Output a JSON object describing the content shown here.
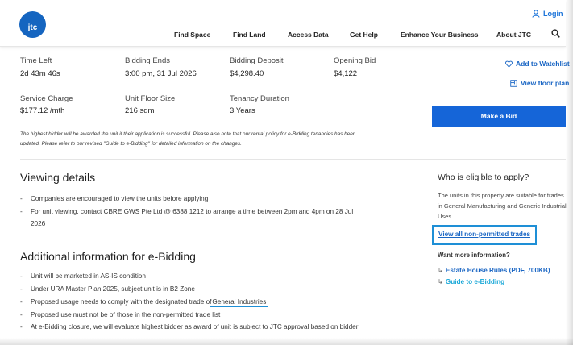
{
  "header": {
    "logo_text": "jtc",
    "login_label": "Login",
    "nav": [
      "Find Space",
      "Find Land",
      "Access Data",
      "Get Help",
      "Enhance Your Business",
      "About JTC"
    ]
  },
  "info": {
    "row1": [
      {
        "label": "Time Left",
        "value": "2d 43m 46s"
      },
      {
        "label": "Bidding Ends",
        "value": "3:00 pm, 31 Jul 2026"
      },
      {
        "label": "Bidding Deposit",
        "value": "$4,298.40"
      },
      {
        "label": "Opening Bid",
        "value": "$4,122"
      }
    ],
    "row2": [
      {
        "label": "Service Charge",
        "value": "$177.12 /mth"
      },
      {
        "label": "Unit Floor Size",
        "value": "216 sqm"
      },
      {
        "label": "Tenancy Duration",
        "value": "3 Years"
      }
    ]
  },
  "actions": {
    "watchlist": "Add to Watchlist",
    "floor_plan": "View floor plan",
    "make_bid": "Make a Bid"
  },
  "note": {
    "line1": "The highest bidder will be awarded the unit if their application is successful. Please also note that our rental policy for e-Bidding tenancies has been",
    "line2": "updated. Please refer to our revised \"Guide to e-Bidding\" for detailed information on the changes."
  },
  "viewing": {
    "title": "Viewing details",
    "items": [
      "Companies are encouraged to view the units before applying",
      "For unit viewing, contact CBRE GWS Pte Ltd @ 6388 1212 to arrange a time between 2pm and 4pm on 28 Jul",
      "2026"
    ]
  },
  "additional": {
    "title": "Additional information for e-Bidding",
    "items": [
      "Unit will be marketed in AS-IS condition",
      "Under URA Master Plan 2025, subject unit is in B2 Zone",
      "Proposed usage needs to comply with the designated trade of",
      "Proposed use must not be of those in the non-permitted trade list",
      "At e-Bidding closure, we will evaluate highest bidder as award of unit is subject to JTC approval based on bidder"
    ],
    "highlight": "General Industries"
  },
  "eligibility": {
    "title": "Who is eligible to apply?",
    "text": "The units in this property are suitable for trades in General Manufacturing and Generic Industrial Uses.",
    "non_permitted_link": "View all non-permitted trades",
    "more_info": "Want more information?",
    "resources": [
      "Estate House Rules (PDF, 700KB)",
      "Guide to e-Bidding"
    ]
  },
  "colors": {
    "brand_blue": "#1565d8",
    "link_blue": "#1a66c4",
    "highlight_blue": "#1e8fd6"
  }
}
